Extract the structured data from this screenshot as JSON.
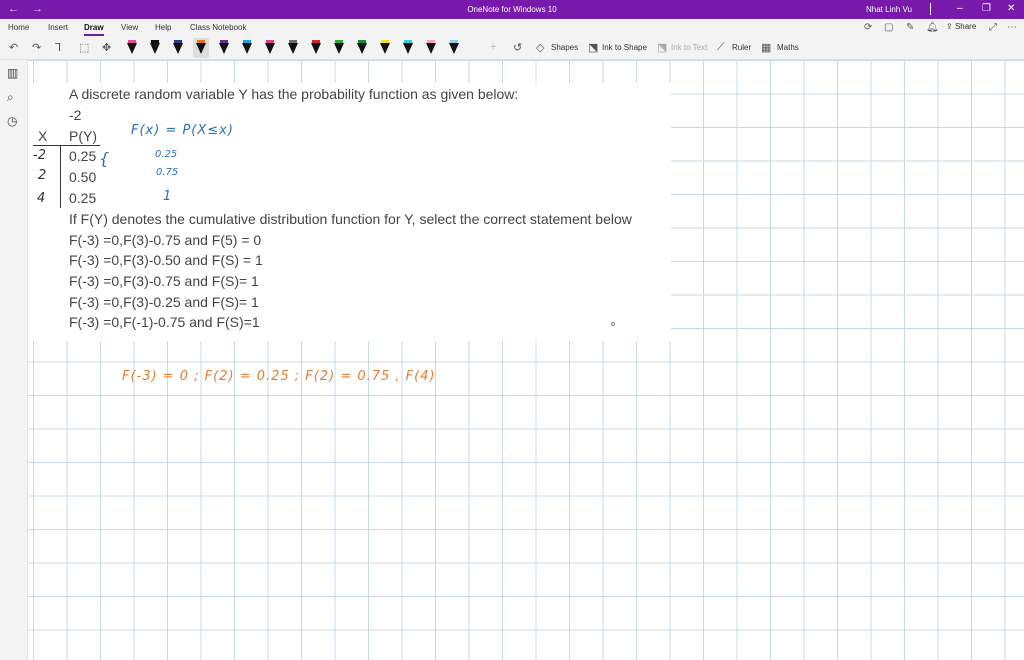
{
  "app": {
    "title": "OneNote for Windows 10",
    "user": "Nhat Linh Vu"
  },
  "menu": {
    "tabs": [
      "Home",
      "Insert",
      "Draw",
      "View",
      "Help",
      "Class Notebook"
    ],
    "active_tab": "Draw",
    "share_label": "Share"
  },
  "toolbar": {
    "shapes_label": "Shapes",
    "ink_to_shape_label": "Ink to Shape",
    "ink_to_text_label": "Ink to Text",
    "ruler_label": "Ruler",
    "maths_label": "Maths",
    "pen_colors": [
      "#e9499a",
      "#111111",
      "#2b3a8f",
      "#e8701e",
      "#6a2a8a",
      "#1f9fd8",
      "#e03c8c",
      "#6b6b6b",
      "#d0282b",
      "#2eaa2e",
      "#1a8a3a",
      "#f0e020",
      "#2ad0d8",
      "#f0a0c8",
      "#8fd0f0"
    ],
    "selected_pen": 3
  },
  "note": {
    "question": "A discrete random variable Y has the probability function as given below:",
    "stray": "-2",
    "table_header_x": "X",
    "table_header_p": "P(Y)",
    "p_values": [
      "0.25",
      "0.50",
      "0.25"
    ],
    "prompt": "If F(Y) denotes the cumulative distribution function for Y, select the correct statement below",
    "options": [
      "F(-3) =0,F(3)-0.75 and F(5) = 0",
      "F(-3) =0,F(3)-0.50 and F(S) = 1",
      "F(-3) =0,F(3)-0.75 and F(S)= 1",
      "F(-3) =0,F(3)-0.25 and F(S)= 1",
      "F(-3) =0,F(-1)-0.75 and F(S)=1"
    ]
  },
  "handwriting": {
    "x_values": [
      "-2",
      "2",
      "4"
    ],
    "cdf_def": "F(x) = P(X≤x)",
    "cdf_values": [
      "0.25",
      "0.75",
      "1"
    ],
    "orange_line": "F(-3) = 0 ;  F(2) = 0.25 ;  F(2) = 0.75 ,  F(4)"
  }
}
